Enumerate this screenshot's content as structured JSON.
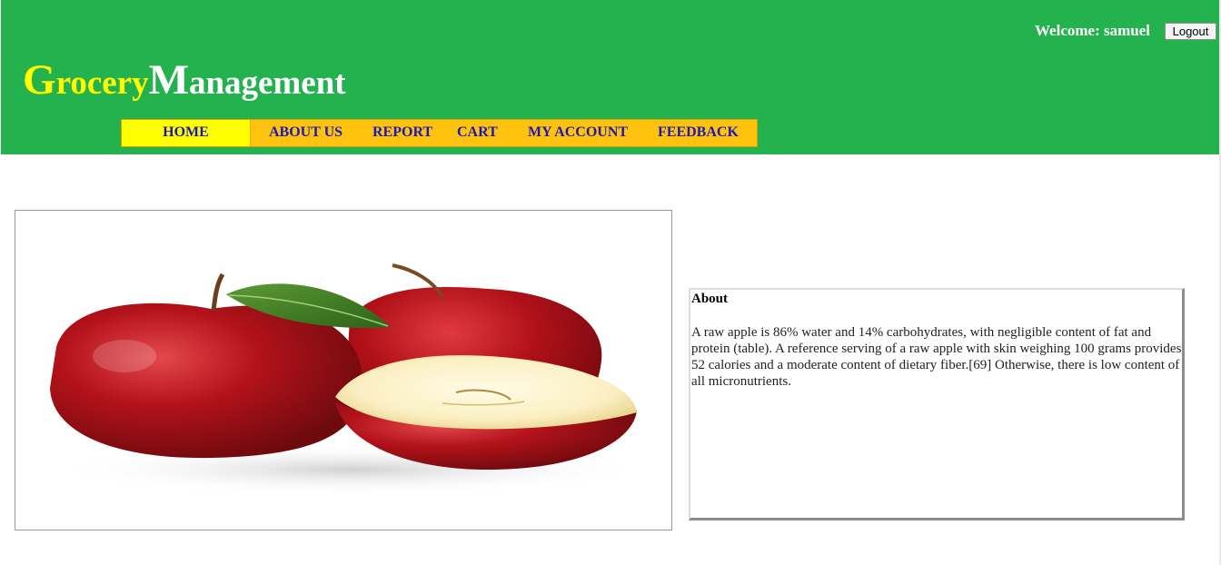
{
  "header": {
    "welcome_label": "Welcome: samuel",
    "logout_label": "Logout",
    "logo": {
      "first_initial": "G",
      "first_rest": "rocery",
      "second_initial": "M",
      "second_rest": "anagement"
    }
  },
  "nav": {
    "items": [
      {
        "label": "HOME",
        "active": true
      },
      {
        "label": "ABOUT US",
        "active": false
      },
      {
        "label": "REPORT",
        "active": false
      },
      {
        "label": "CART",
        "active": false
      },
      {
        "label": "MY ACCOUNT",
        "active": false
      },
      {
        "label": "FEEDBACK",
        "active": false
      }
    ]
  },
  "main": {
    "image": {
      "icon": "apples-photo"
    },
    "about": {
      "title": "About",
      "text": "A raw apple is 86% water and 14% carbohydrates, with negligible content of fat and protein (table). A reference serving of a raw apple with skin weighing 100 grams provides 52 calories and a moderate content of dietary fiber.[69] Otherwise, there is low content of all micronutrients."
    }
  },
  "colors": {
    "header_bg": "#24b24e",
    "nav_bg": "#ffc20f",
    "nav_active_bg": "#ffff00",
    "nav_text": "#1b1bb4",
    "logo_accent": "#ffff00"
  }
}
